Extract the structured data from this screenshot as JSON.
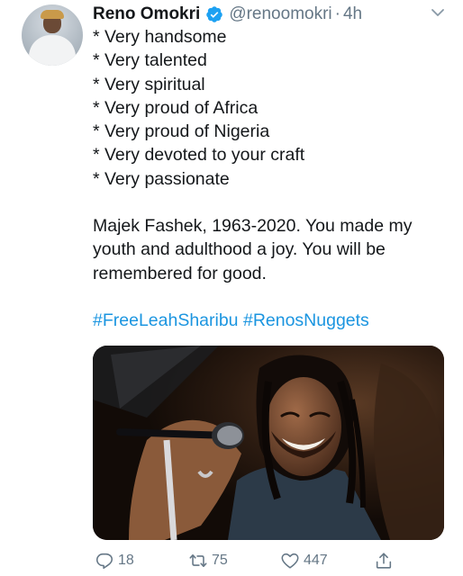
{
  "tweet": {
    "author_name": "Reno Omokri",
    "handle": "@renoomokri",
    "separator": "·",
    "time": "4h",
    "bullets": [
      "* Very handsome",
      "* Very talented",
      "* Very spiritual",
      "* Very proud of Africa",
      "* Very proud of Nigeria",
      "* Very devoted to your craft",
      "* Very passionate"
    ],
    "paragraph": "Majek Fashek, 1963-2020. You made my youth and adulthood a joy. You will be remembered for good.",
    "hashtags": [
      "#FreeLeahSharibu",
      "#RenosNuggets"
    ],
    "replies": "18",
    "retweets": "75",
    "likes": "447"
  },
  "colors": {
    "text": "#14171a",
    "secondary": "#657786",
    "link": "#1b95e0",
    "verified": "#1da1f2"
  },
  "icons": [
    "verified-badge-icon",
    "chevron-down-icon",
    "reply-icon",
    "retweet-icon",
    "like-icon",
    "share-icon"
  ]
}
